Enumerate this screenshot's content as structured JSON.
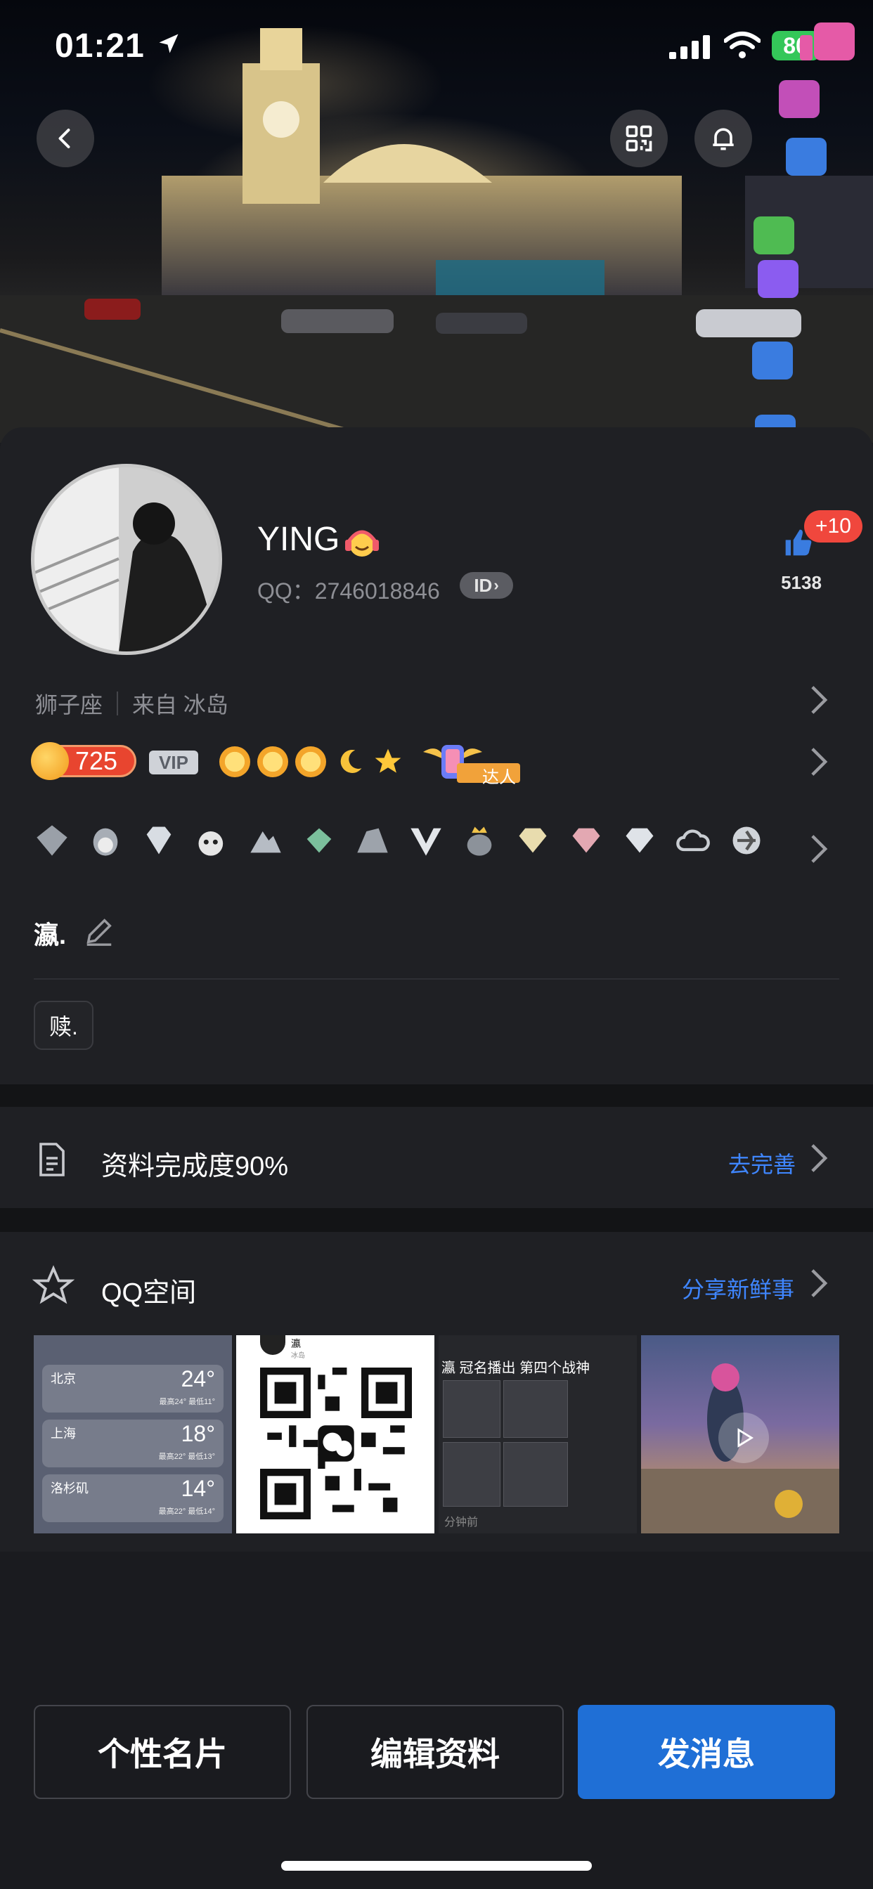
{
  "status_bar": {
    "time": "01:21",
    "battery": "80"
  },
  "profile": {
    "name": "YING",
    "qq_label": "QQ：2746018846",
    "id_badge": "ID",
    "like_plus": "+10",
    "like_count": "5138",
    "zodiac": "狮子座",
    "location": "来自 冰岛",
    "level": "725",
    "vip": "VIP",
    "daren_label": "达人",
    "signature": "瀛.",
    "tag": "赎."
  },
  "sections": {
    "completeness": {
      "title": "资料完成度90%",
      "link": "去完善"
    },
    "qzone": {
      "title": "QQ空间",
      "link": "分享新鲜事",
      "thumbnails": {
        "weather": [
          {
            "city": "北京",
            "temp": "24°",
            "range": "最高24° 最低11°"
          },
          {
            "city": "上海",
            "temp": "18°",
            "range": "最高22° 最低13°"
          },
          {
            "city": "洛杉矶",
            "temp": "14°",
            "range": "最高22° 最低14°"
          }
        ],
        "qr_name": "瀛",
        "qr_sub": "冰岛",
        "post_title": "瀛 冠名播出 第四个战神",
        "post_time": "分钟前"
      }
    }
  },
  "actions": {
    "card": "个性名片",
    "edit": "编辑资料",
    "message": "发消息"
  },
  "colors": {
    "accent": "#1f6fd6",
    "link": "#3f86ff",
    "level_badge": "#e8452f",
    "like_plus": "#f0473d"
  },
  "icons": [
    "back-icon",
    "qr-code-icon",
    "bell-icon",
    "thumbs-up-icon",
    "edit-icon",
    "document-icon",
    "star-icon",
    "play-icon",
    "location-arrow-icon",
    "wifi-icon",
    "signal-icon"
  ]
}
